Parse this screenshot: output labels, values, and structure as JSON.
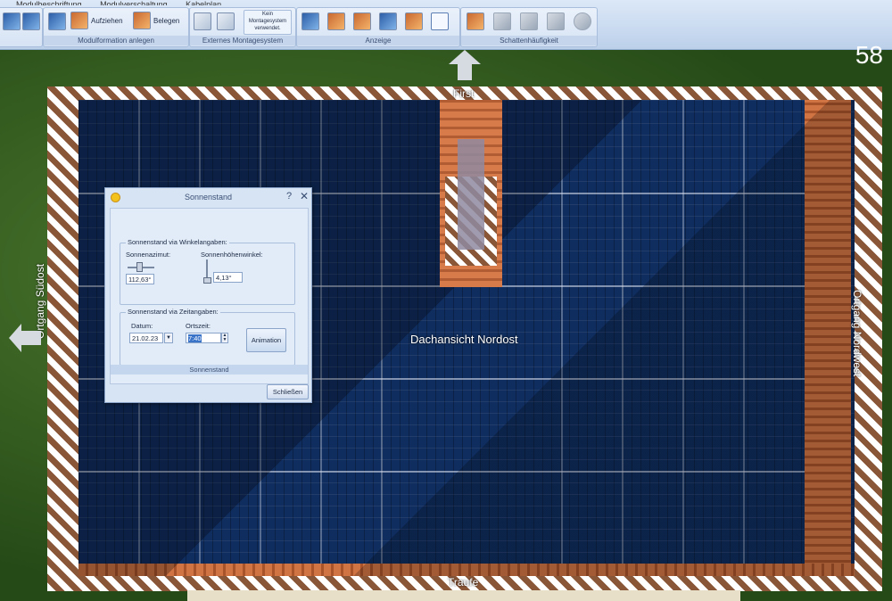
{
  "menu": [
    "Modulbeschriftung",
    "Modulverschaltung",
    "Kabelplan"
  ],
  "ribbon": {
    "groups": [
      {
        "label": "Modulformation anlegen",
        "buttons": [
          "Aufziehen",
          "Belegen"
        ]
      },
      {
        "label": "Externes Montagesystem",
        "status": "Kein Montagesystem verwendet."
      },
      {
        "label": "Anzeige"
      },
      {
        "label": "Schattenhäufigkeit"
      }
    ]
  },
  "counter": "58",
  "roof": {
    "center_label": "Dachansicht Nordost",
    "top_label": "First",
    "bottom_label": "Traufe",
    "left_label": "Ortgang Südost",
    "right_label": "Ortgang Nordwest"
  },
  "dialog": {
    "title": "Sonnenstand",
    "help": "?",
    "close_x": "✕",
    "section1": "Sonnenstand via Winkelangaben:",
    "azimut_label": "Sonnenazimut:",
    "azimut_value": "112,63°",
    "hoehe_label": "Sonnenhöhenwinkel:",
    "hoehe_value": "4,13°",
    "section2": "Sonnenstand via Zeitangaben:",
    "datum_label": "Datum:",
    "datum_value": "21.02.23",
    "ortszeit_label": "Ortszeit:",
    "ortszeit_value": "7:40",
    "animation_button": "Animation",
    "tab_label": "Sonnenstand",
    "close_button": "Schließen"
  },
  "colors": {
    "ribbon_bg": "#c9daf0",
    "panel_blue": "#0f2d5e",
    "tile": "#d07444",
    "grass": "#2e5a1f"
  }
}
